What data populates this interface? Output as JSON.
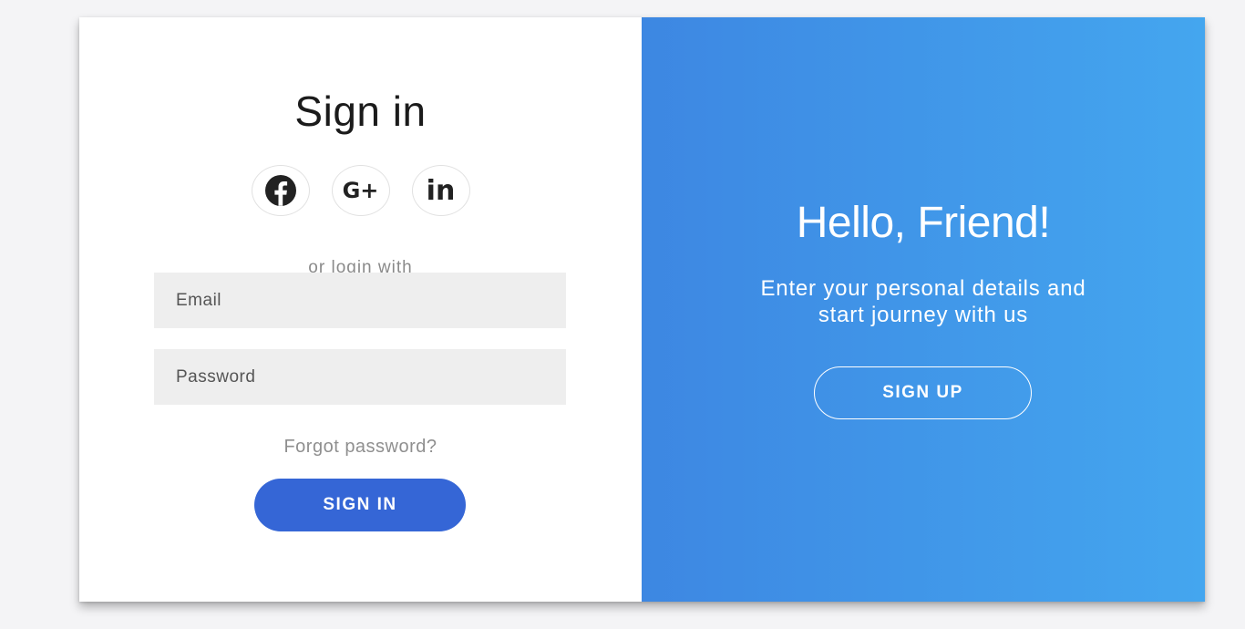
{
  "signin_panel": {
    "title": "Sign in",
    "social_buttons": [
      {
        "name": "facebook",
        "icon": "facebook-icon"
      },
      {
        "name": "google-plus",
        "icon": "google-plus-icon",
        "label": "G+"
      },
      {
        "name": "linkedin",
        "icon": "linkedin-icon",
        "label": "in"
      }
    ],
    "or_login_text": "or login with",
    "email_placeholder": "Email",
    "password_placeholder": "Password",
    "forgot_password": "Forgot password?",
    "signin_button": "SIGN IN"
  },
  "signup_panel": {
    "title": "Hello, Friend!",
    "subtext_line1": "Enter your personal details and",
    "subtext_line2": "start journey with us",
    "signup_button": "SIGN UP"
  },
  "colors": {
    "primary_button": "#3566d6",
    "panel_gradient_start": "#3d87e2",
    "panel_gradient_end": "#44a6ef",
    "input_background": "#eeeeee"
  }
}
